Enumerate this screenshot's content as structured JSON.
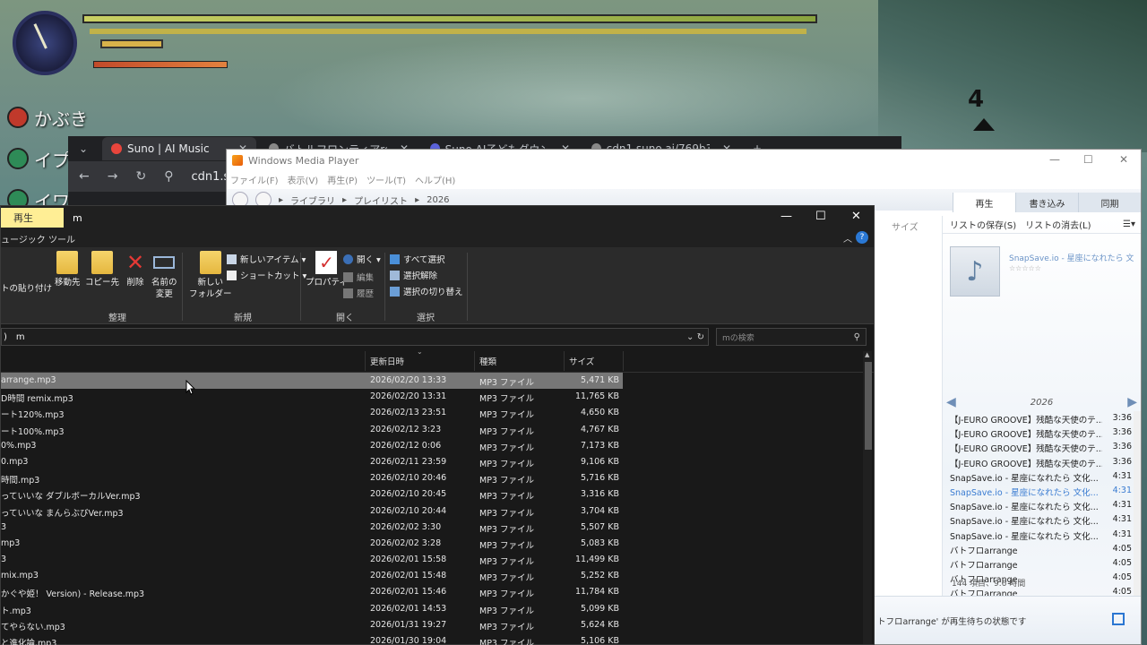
{
  "game": {
    "party": [
      "かぶき",
      "イプ",
      "イワ"
    ],
    "area_digit": "4"
  },
  "chrome": {
    "tabs": [
      {
        "title": "Suno | AI Music",
        "active": true
      },
      {
        "title": "バトルフロンティアremix3 by",
        "active": false
      },
      {
        "title": "Suno AI子どもダウンロード",
        "active": false
      },
      {
        "title": "cdn1.suno.ai/769b3705-5",
        "active": false
      }
    ],
    "new_tab": "+",
    "url": "cdn1.sun"
  },
  "wmp": {
    "title": "Windows Media Player",
    "window_controls": {
      "min": "—",
      "max": "☐",
      "close": "✕"
    },
    "menu": [
      "ファイル(F)",
      "表示(V)",
      "再生(P)",
      "ツール(T)",
      "ヘルプ(H)"
    ],
    "breadcrumb": [
      "ライブラリ",
      "プレイリスト",
      "2026"
    ],
    "tabs": [
      "再生",
      "書き込み",
      "同期"
    ],
    "list_tools": {
      "save": "リストの保存(S)",
      "clear": "リストの消去(L)"
    },
    "size_column": "サイズ",
    "now_playing": {
      "title": "SnapSave.io - 星座になれたら 文...",
      "stars": "☆☆☆☆☆"
    },
    "year": "2026",
    "playlist": [
      {
        "title": "【J-EURO GROOVE】残酷な天使のテ...",
        "dur": "3:36",
        "current": false
      },
      {
        "title": "【J-EURO GROOVE】残酷な天使のテ...",
        "dur": "3:36",
        "current": false
      },
      {
        "title": "【J-EURO GROOVE】残酷な天使のテ...",
        "dur": "3:36",
        "current": false
      },
      {
        "title": "【J-EURO GROOVE】残酷な天使のテ...",
        "dur": "3:36",
        "current": false
      },
      {
        "title": "SnapSave.io - 星座になれたら 文化...",
        "dur": "4:31",
        "current": false
      },
      {
        "title": "SnapSave.io - 星座になれたら 文化...",
        "dur": "4:31",
        "current": true
      },
      {
        "title": "SnapSave.io - 星座になれたら 文化...",
        "dur": "4:31",
        "current": false
      },
      {
        "title": "SnapSave.io - 星座になれたら 文化...",
        "dur": "4:31",
        "current": false
      },
      {
        "title": "SnapSave.io - 星座になれたら 文化...",
        "dur": "4:31",
        "current": false
      },
      {
        "title": "バトフロarrange",
        "dur": "4:05",
        "current": false
      },
      {
        "title": "バトフロarrange",
        "dur": "4:05",
        "current": false
      },
      {
        "title": "バトフロarrange",
        "dur": "4:05",
        "current": false
      },
      {
        "title": "バトフロarrange",
        "dur": "4:05",
        "current": false
      },
      {
        "title": "バトフロarrange",
        "dur": "4:05",
        "current": false
      },
      {
        "title": "バトフロarrange",
        "dur": "4:05",
        "current": false
      }
    ],
    "count": "144 項目、9.6 時間",
    "status": "トフロarrange' が再生待ちの状態です"
  },
  "explorer": {
    "context_tab": "再生",
    "title": "m",
    "window_controls": {
      "min": "—",
      "max": "☐",
      "close": "✕"
    },
    "ribbon_context": "ュージック ツール",
    "ribbon": {
      "paste_shortcut": "トの貼り付け",
      "move_to": "移動先",
      "copy_to": "コピー先",
      "delete": "削除",
      "rename": "名前の\n変更",
      "new_folder": "新しい\nフォルダー",
      "new_item": "新しいアイテム ▾",
      "shortcut": "ショートカット ▾",
      "properties": "プロパティ",
      "open": "開く ▾",
      "edit": "編集",
      "history": "履歴",
      "select_all": "すべて選択",
      "select_none": "選択解除",
      "invert": "選択の切り替え",
      "groups": {
        "organize": "整理",
        "new": "新規",
        "open": "開く",
        "select": "選択"
      }
    },
    "address": {
      "prefix": ")",
      "folder": "m"
    },
    "search_placeholder": "mの検索",
    "columns": {
      "date": "更新日時",
      "type": "種類",
      "size": "サイズ"
    },
    "files": [
      {
        "name": "arrange.mp3",
        "date": "2026/02/20 13:33",
        "type": "MP3 ファイル",
        "size": "5,471 KB",
        "selected": true
      },
      {
        "name": "D時間 remix.mp3",
        "date": "2026/02/20 13:31",
        "type": "MP3 ファイル",
        "size": "11,765 KB",
        "selected": false
      },
      {
        "name": "ート120%.mp3",
        "date": "2026/02/13 23:51",
        "type": "MP3 ファイル",
        "size": "4,650 KB",
        "selected": false
      },
      {
        "name": "ート100%.mp3",
        "date": "2026/02/12 3:23",
        "type": "MP3 ファイル",
        "size": "4,767 KB",
        "selected": false
      },
      {
        "name": "0%.mp3",
        "date": "2026/02/12 0:06",
        "type": "MP3 ファイル",
        "size": "7,173 KB",
        "selected": false
      },
      {
        "name": "0.mp3",
        "date": "2026/02/11 23:59",
        "type": "MP3 ファイル",
        "size": "9,106 KB",
        "selected": false
      },
      {
        "name": "時間.mp3",
        "date": "2026/02/10 20:46",
        "type": "MP3 ファイル",
        "size": "5,716 KB",
        "selected": false
      },
      {
        "name": "っていいな ダブルボーカルVer.mp3",
        "date": "2026/02/10 20:45",
        "type": "MP3 ファイル",
        "size": "3,316 KB",
        "selected": false
      },
      {
        "name": "っていいな まんらぶびVer.mp3",
        "date": "2026/02/10 20:44",
        "type": "MP3 ファイル",
        "size": "3,704 KB",
        "selected": false
      },
      {
        "name": "3",
        "date": "2026/02/02 3:30",
        "type": "MP3 ファイル",
        "size": "5,507 KB",
        "selected": false
      },
      {
        "name": "mp3",
        "date": "2026/02/02 3:28",
        "type": "MP3 ファイル",
        "size": "5,083 KB",
        "selected": false
      },
      {
        "name": "3",
        "date": "2026/02/01 15:58",
        "type": "MP3 ファイル",
        "size": "11,499 KB",
        "selected": false
      },
      {
        "name": "mix.mp3",
        "date": "2026/02/01 15:48",
        "type": "MP3 ファイル",
        "size": "5,252 KB",
        "selected": false
      },
      {
        "name": "かぐや姫！ Version) - Release.mp3",
        "date": "2026/02/01 15:46",
        "type": "MP3 ファイル",
        "size": "11,784 KB",
        "selected": false
      },
      {
        "name": "ト.mp3",
        "date": "2026/02/01 14:53",
        "type": "MP3 ファイル",
        "size": "5,099 KB",
        "selected": false
      },
      {
        "name": "てやらない.mp3",
        "date": "2026/01/31 19:27",
        "type": "MP3 ファイル",
        "size": "5,624 KB",
        "selected": false
      },
      {
        "name": "と進化論.mp3",
        "date": "2026/01/30 19:04",
        "type": "MP3 ファイル",
        "size": "5,106 KB",
        "selected": false
      }
    ]
  }
}
